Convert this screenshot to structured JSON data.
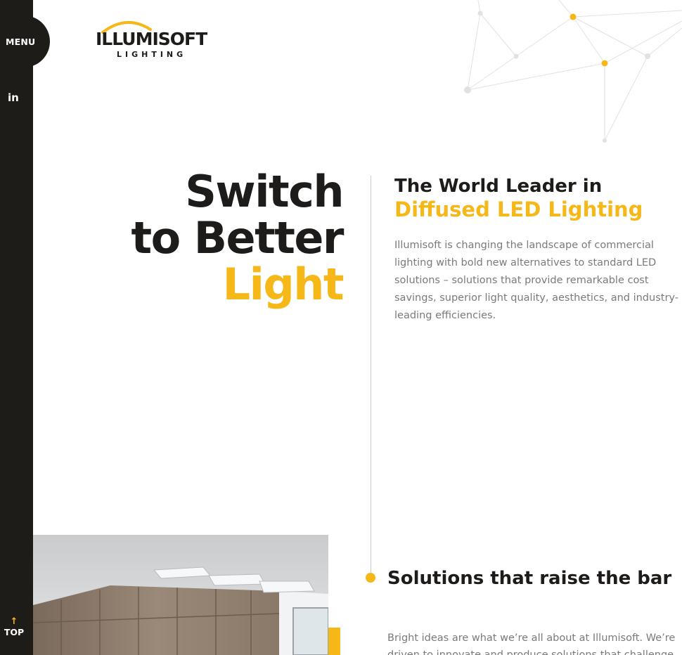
{
  "nav": {
    "menu_label": "MENU",
    "social_icon": "linkedin-icon",
    "social_label": "in",
    "top_label": "TOP",
    "top_icon": "arrow-up-icon",
    "top_arrow": "↑"
  },
  "logo": {
    "wordmark": "ILLUMISOFT",
    "tagline": "LIGHTING"
  },
  "hero": {
    "headline": [
      "Switch",
      "to Better",
      "Light"
    ],
    "subheading_line1": "The World Leader in",
    "subheading_line2": "Diffused LED Lighting",
    "intro": "Illumisoft is changing the landscape of commercial lighting with bold new alternatives to standard LED solutions – solutions that provide remarkable cost savings, superior light quality, aesthetics, and industry-leading efficiencies."
  },
  "section": {
    "title": "Solutions that raise the bar",
    "body": "Bright ideas are what we’re all about at Illumisoft. We’re driven to innovate and produce solutions that challenge"
  },
  "colors": {
    "accent": "#f6b719",
    "dark": "#1d1c18",
    "text": "#1d1c1a",
    "muted": "#7a7a7a"
  }
}
